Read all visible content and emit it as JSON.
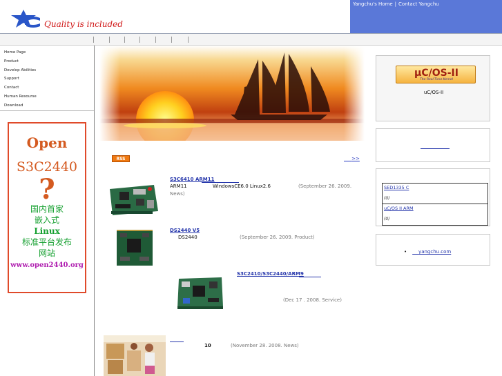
{
  "header": {
    "slogan": "Quality is included",
    "top_links": [
      "Yangchu's Home",
      "Contact Yangchu"
    ],
    "separator": "|",
    "colors": {
      "topbar": "#5a78d8",
      "slogan": "#d01818",
      "logo": "#2a56c8"
    }
  },
  "sidebar": {
    "menu": [
      "Home Page",
      "Product",
      "Develop Abilities",
      "Support",
      "Contact",
      "Human Resourse",
      "Download"
    ]
  },
  "ad": {
    "line1": "Open",
    "line2": "S3C2440",
    "line3": "?",
    "line4": "国内首家",
    "line5": "嵌入式",
    "line6": "Linux",
    "line7": "标准平台发布",
    "line8": "网站",
    "url": "www.open2440.org"
  },
  "news": {
    "rss_label": "RSS",
    "more_label": ">>",
    "items": [
      {
        "title": "S3C6410 ARM11",
        "text1": "ARM11",
        "text2": "WindowsCE6.0 Linux2.6",
        "meta": "(September 26. 2009.",
        "meta2": "News)"
      },
      {
        "title": "DS2440 V5",
        "text1": "DS2440",
        "meta": "(September 26. 2009. Product)"
      },
      {
        "title": "S3C2410/S3C2440/ARM9",
        "meta": "(Dec 17 . 2008. Service)"
      },
      {
        "title": "",
        "text1": "10",
        "meta": "(November 28. 2008. News)"
      }
    ]
  },
  "right": {
    "ucos_logo": "µC/OS-II",
    "ucos_tagline": "The Real-Time Kernel",
    "ucos_caption": "uC/OS-II",
    "table": [
      {
        "title": "SED1335 C",
        "count": "(0)"
      },
      {
        "title": "uC/OS II ARM",
        "count": "(0)"
      }
    ],
    "bullet_link": "yangchu.com"
  }
}
